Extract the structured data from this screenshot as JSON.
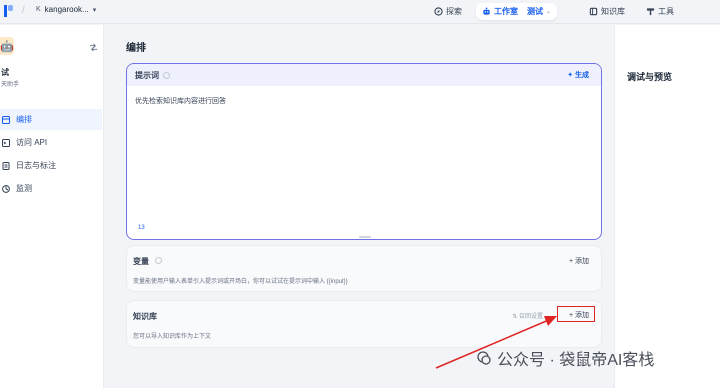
{
  "topbar": {
    "workspace_badge": "K",
    "workspace_name": "kangarook...",
    "nav": {
      "explore": "探索",
      "studio": "工作室",
      "studio_app": "测试",
      "knowledge": "知识库",
      "tools": "工具"
    }
  },
  "sidebar": {
    "app_name": "试",
    "app_type": "天助手",
    "items": [
      {
        "label": "编排",
        "icon": "layout-icon"
      },
      {
        "label": "访问 API",
        "icon": "terminal-icon"
      },
      {
        "label": "日志与标注",
        "icon": "document-icon"
      },
      {
        "label": "监测",
        "icon": "monitor-icon"
      }
    ]
  },
  "main": {
    "title": "编排",
    "prompt": {
      "title": "提示词",
      "generate_label": "生成",
      "text": "优先检索知识库内容进行回答",
      "char_count": "13"
    },
    "variables": {
      "title": "变量",
      "add_label": "添加",
      "description": "变量能使用户输入表单引入提示词或开场白，你可以试试在提示词中输入 {{input}}"
    },
    "knowledge": {
      "title": "知识库",
      "settings_label": "召回设置",
      "add_label": "添加",
      "description": "您可以导入知识库作为上下文"
    }
  },
  "right_panel": {
    "title": "调试与预览"
  },
  "watermark": "公众号 · 袋鼠帝AI客栈",
  "colors": {
    "accent": "#155eef",
    "prompt_border": "#6e74e8",
    "highlight": "#e02424"
  }
}
